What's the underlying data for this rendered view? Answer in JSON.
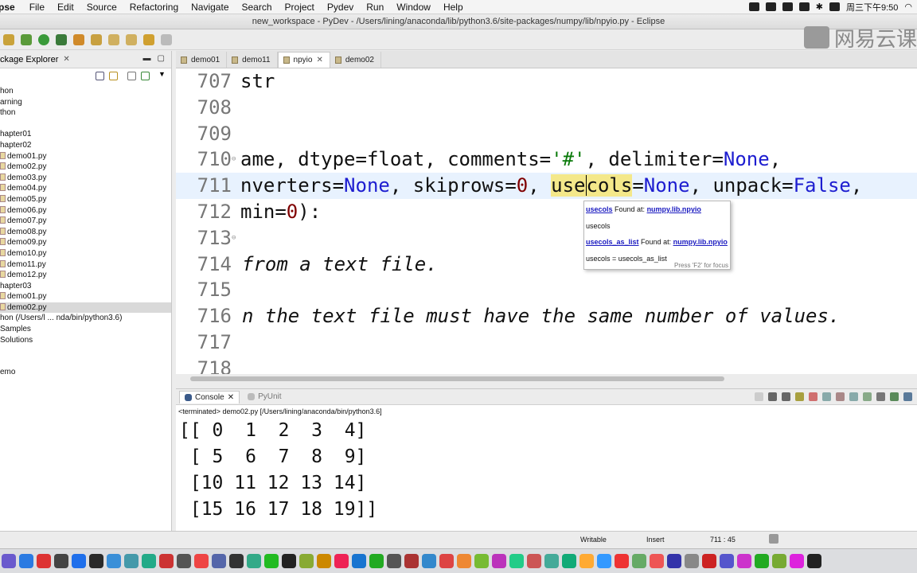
{
  "menubar": {
    "app": "pse",
    "items": [
      "File",
      "Edit",
      "Source",
      "Refactoring",
      "Navigate",
      "Search",
      "Project",
      "Pydev",
      "Run",
      "Window",
      "Help"
    ],
    "clock": "周三下午9:50"
  },
  "window": {
    "title": "new_workspace - PyDev - /Users/lining/anaconda/lib/python3.6/site-packages/numpy/lib/npyio.py - Eclipse"
  },
  "watermark": {
    "text": "网易云课"
  },
  "explorer": {
    "title": "ckage Explorer",
    "items": [
      {
        "label": "hon",
        "selected": false
      },
      {
        "label": "arning",
        "selected": false
      },
      {
        "label": "thon",
        "selected": false
      },
      {
        "label": "",
        "selected": false
      },
      {
        "label": "hapter01",
        "selected": false
      },
      {
        "label": "hapter02",
        "selected": false
      },
      {
        "label": "demo01.py",
        "selected": false,
        "file": true
      },
      {
        "label": "demo02.py",
        "selected": false,
        "file": true
      },
      {
        "label": "demo03.py",
        "selected": false,
        "file": true
      },
      {
        "label": "demo04.py",
        "selected": false,
        "file": true
      },
      {
        "label": "demo05.py",
        "selected": false,
        "file": true
      },
      {
        "label": "demo06.py",
        "selected": false,
        "file": true
      },
      {
        "label": "demo07.py",
        "selected": false,
        "file": true
      },
      {
        "label": "demo08.py",
        "selected": false,
        "file": true
      },
      {
        "label": "demo09.py",
        "selected": false,
        "file": true
      },
      {
        "label": "demo10.py",
        "selected": false,
        "file": true
      },
      {
        "label": "demo11.py",
        "selected": false,
        "file": true
      },
      {
        "label": "demo12.py",
        "selected": false,
        "file": true
      },
      {
        "label": "hapter03",
        "selected": false
      },
      {
        "label": "demo01.py",
        "selected": false,
        "file": true
      },
      {
        "label": "demo02.py",
        "selected": true,
        "file": true
      },
      {
        "label": "hon  (/Users/l ... nda/bin/python3.6)",
        "selected": false
      },
      {
        "label": "Samples",
        "selected": false
      },
      {
        "label": "Solutions",
        "selected": false
      },
      {
        "label": "",
        "selected": false
      },
      {
        "label": "",
        "selected": false
      },
      {
        "label": "emo",
        "selected": false
      }
    ]
  },
  "editor_tabs": [
    {
      "label": "demo01",
      "active": false,
      "closable": false
    },
    {
      "label": "demo11",
      "active": false,
      "closable": false
    },
    {
      "label": "npyio",
      "active": true,
      "closable": true
    },
    {
      "label": "demo02",
      "active": false,
      "closable": false
    }
  ],
  "editor": {
    "lines": [
      {
        "num": "707",
        "fold": "",
        "current": false
      },
      {
        "num": "708",
        "fold": "",
        "current": false
      },
      {
        "num": "709",
        "fold": "",
        "current": false
      },
      {
        "num": "710",
        "fold": "⊖",
        "current": false
      },
      {
        "num": "711",
        "fold": "",
        "current": true
      },
      {
        "num": "712",
        "fold": "",
        "current": false
      },
      {
        "num": "713",
        "fold": "⊖",
        "current": false
      },
      {
        "num": "714",
        "fold": "",
        "current": false
      },
      {
        "num": "715",
        "fold": "",
        "current": false
      },
      {
        "num": "716",
        "fold": "",
        "current": false
      },
      {
        "num": "717",
        "fold": "",
        "current": false
      },
      {
        "num": "718",
        "fold": "",
        "current": false
      }
    ],
    "code": {
      "l707": "str",
      "l710": {
        "a": "ame, dtype=float, comments=",
        "b": "'#'",
        "c": ", delimiter=",
        "d": "None",
        "e": ","
      },
      "l711": {
        "a": "nverters=",
        "b": "None",
        "c": ", skiprows=",
        "d": "0",
        "e": ", ",
        "f": "use",
        "g": "cols",
        "h": "=",
        "i": "None",
        "j": ", unpack=",
        "k": "False",
        "l": ","
      },
      "l712": {
        "a": "min=",
        "b": "0",
        "c": "):"
      },
      "l714": "from a text file.",
      "l716": "n the text file must have the same number of values."
    }
  },
  "autocomplete": {
    "row1_name": "usecols",
    "row1_text": " Found at: ",
    "row1_module": "numpy.lib.npyio",
    "row2": "usecols",
    "row3_name": "usecols_as_list",
    "row3_text": " Found at: ",
    "row3_module": "numpy.lib.npyio",
    "row4": "usecols = usecols_as_list",
    "footer": "Press 'F2' for focus"
  },
  "console": {
    "tabs": [
      {
        "label": "Console",
        "active": true
      },
      {
        "label": "PyUnit",
        "active": false
      }
    ],
    "status": "<terminated> demo02.py [/Users/lining/anaconda/bin/python3.6]",
    "output": [
      "[[ 0  1  2  3  4]",
      " [ 5  6  7  8  9]",
      " [10 11 12 13 14]",
      " [15 16 17 18 19]]"
    ]
  },
  "statusbar": {
    "writable": "Writable",
    "insert": "Insert",
    "position": "711 : 45"
  },
  "colors": {
    "keyword": "#1d1dd0",
    "string": "#0a7a0a",
    "comment": "#3bb43b",
    "number": "#800000",
    "current_line": "#e8f2fe",
    "highlight": "#f4e88a"
  }
}
